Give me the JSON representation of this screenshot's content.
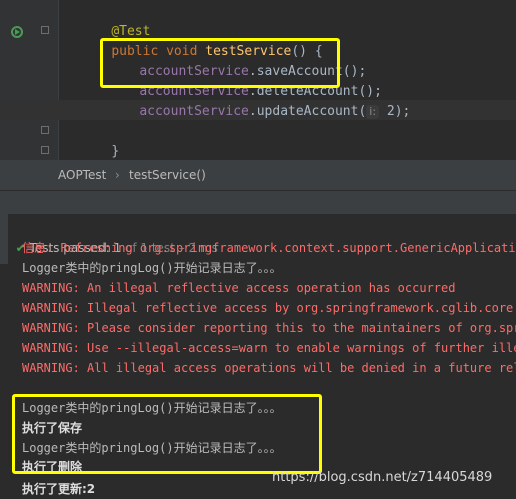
{
  "editor": {
    "lines": {
      "annotation": "@Test",
      "sig_public": "public",
      "sig_void": "void",
      "sig_name": "testService",
      "sig_rest": "() {",
      "save_obj": "accountService",
      "save_call": ".saveAccount();",
      "delete_obj": "accountService",
      "delete_call": ".deleteAccount();",
      "update_obj": "accountService",
      "update_call": ".updateAccount(",
      "update_hint": "i:",
      "update_arg": " 2);",
      "close_inner": "}",
      "close_outer": "}"
    }
  },
  "breadcrumb": {
    "class_name": "AOPTest",
    "separator": "›",
    "method_name": "testService()"
  },
  "console": {
    "status_label": "Tests passed: ",
    "status_count": "1",
    "status_rest": " of 1 test – 2 ms",
    "lines": [
      "信息: Refreshing org.springframework.context.support.GenericApplication",
      "Logger类中的pringLog()开始记录日志了。。。",
      "WARNING: An illegal reflective access operation has occurred",
      "WARNING: Illegal reflective access by org.springframework.cglib.core.Re",
      "WARNING: Please consider reporting this to the maintainers of org.spri",
      "WARNING: Use --illegal-access=warn to enable warnings of further illeg",
      "WARNING: All illegal access operations will be denied in a future rele",
      "Logger类中的pringLog()开始记录日志了。。。",
      "执行了保存",
      "Logger类中的pringLog()开始记录日志了。。。",
      "执行了删除",
      "执行了更新:2"
    ]
  },
  "watermark": "https://blog.csdn.net/z714405489",
  "colors": {
    "highlight_box": "#ffff00",
    "warning_text": "#ff6b68",
    "pass_check": "#499c54"
  }
}
